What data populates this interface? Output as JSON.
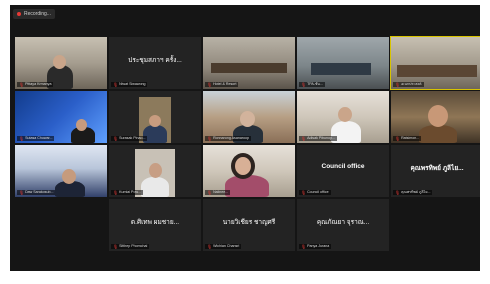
{
  "window": {
    "status_text": "Recording..."
  },
  "tiles": [
    {
      "name": "",
      "label": "Pittaya Krmanya"
    },
    {
      "name": "ประชุมสภาฯ ครั้ง...",
      "label": "Niwat Siwawong"
    },
    {
      "name": "",
      "label": "Hotel & Resort"
    },
    {
      "name": "",
      "label": "TPA-ชั้น..."
    },
    {
      "name": "",
      "label": "อเนกประสงค์"
    },
    {
      "name": "",
      "label": "Sutasa Chuwar..."
    },
    {
      "name": "",
      "label": "Surasak Pinao..."
    },
    {
      "name": "",
      "label": "Ronnarong Asanaroop"
    },
    {
      "name": "",
      "label": "Adisak Pibunop..."
    },
    {
      "name": "",
      "label": "Ratsimon..."
    },
    {
      "name": "",
      "label": "Daw Sarakosub..."
    },
    {
      "name": "",
      "label": "Kumlai Pow..."
    },
    {
      "name": "",
      "label": "Nalinee..."
    },
    {
      "name": "Council office",
      "label": "Council office"
    },
    {
      "name": "คุณพรทิพย์ ภูลิไย...",
      "label": "คุณพรทิพย์ ภูลิไย..."
    },
    {
      "name": "ด.ศิเทพ ผมชาย...",
      "label": "Sitthep Phomchai"
    },
    {
      "name": "นายวิเชียร ชาญศรี",
      "label": "Wichian Chansri"
    },
    {
      "name": "คุณภัณยา จุราณ...",
      "label": "Panya Jurana"
    }
  ]
}
